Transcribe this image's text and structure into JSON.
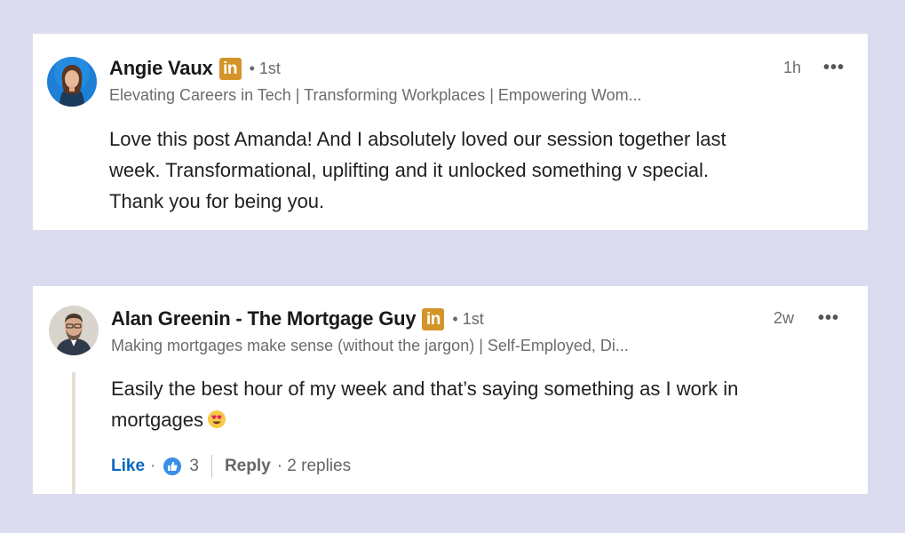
{
  "comments": [
    {
      "author": "Angie Vaux",
      "badge": "in",
      "degree": "• 1st",
      "headline": "Elevating Careers in Tech | Transforming Workplaces | Empowering Wom...",
      "time": "1h",
      "more": "•••",
      "body_lines": [
        "Love this post Amanda! And I absolutely loved our session together last",
        "week. Transformational, uplifting and it unlocked something v special.",
        "Thank you for being you."
      ]
    },
    {
      "author": "Alan Greenin - The Mortgage Guy",
      "badge": "in",
      "degree": "• 1st",
      "headline": "Making mortgages make sense (without the jargon) | Self-Employed, Di...",
      "time": "2w",
      "more": "•••",
      "body_lines": [
        "Easily the best hour of my week and that’s saying something as I work in",
        "mortgages"
      ],
      "actions": {
        "like": "Like",
        "dot": "·",
        "reaction_count": "3",
        "reply": "Reply",
        "replies": "· 2 replies"
      }
    }
  ],
  "colors": {
    "background": "#dcdcf0",
    "badge": "#d4942a",
    "like": "#0a66c2"
  },
  "icons": {
    "premium_badge": "linkedin-in-icon",
    "more": "more-horizontal-icon",
    "reaction": "thumbs-up-icon",
    "emoji": "heart-eyes-emoji-icon"
  }
}
